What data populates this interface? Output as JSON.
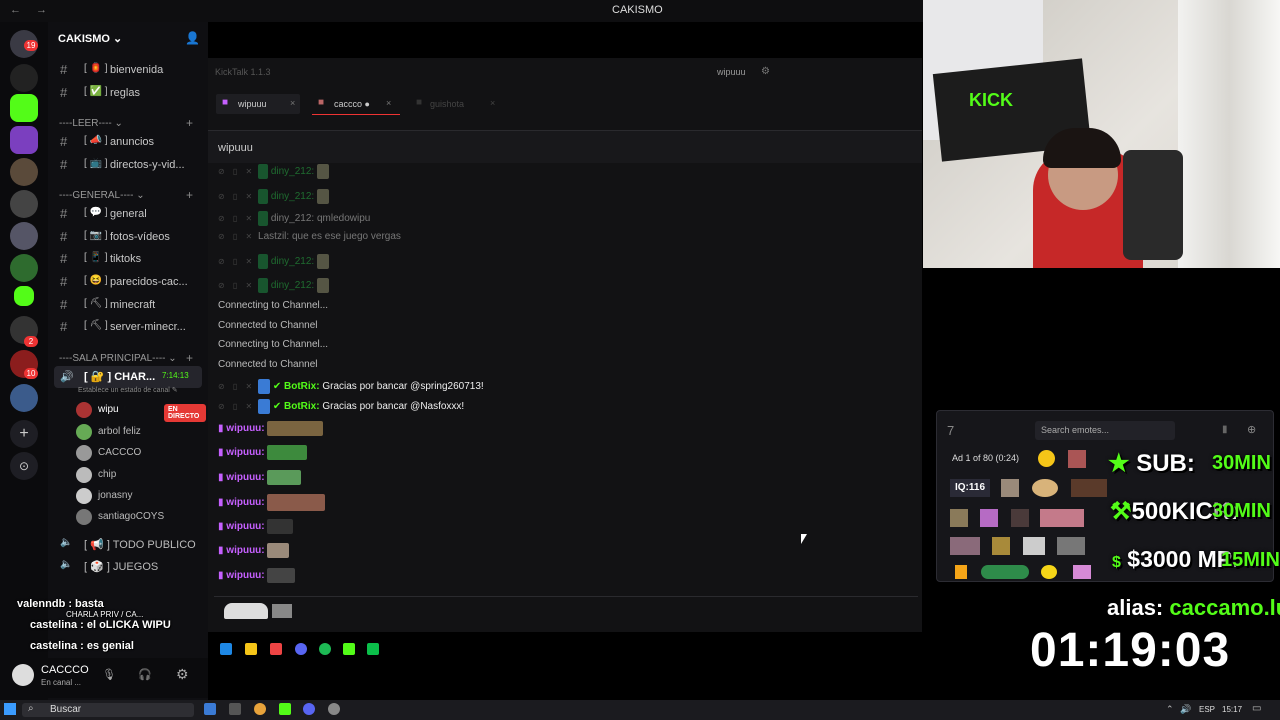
{
  "window": {
    "title": "CAKISMO",
    "nav_arrows": "← →"
  },
  "server": {
    "name": "CAKISMO ⌄"
  },
  "rail_badges": [
    "19",
    "2",
    "10"
  ],
  "channels_top": [
    {
      "emoji": "[ 🏮 ]",
      "name": "bienvenida"
    },
    {
      "emoji": "[ ✅ ]",
      "name": "reglas"
    }
  ],
  "categories": {
    "leer": "----LEER---- ⌄",
    "general": "----GENERAL---- ⌄",
    "sala": "----SALA PRINCIPAL---- ⌄"
  },
  "channels_leer": [
    {
      "emoji": "[ 📣 ]",
      "name": "anuncios"
    },
    {
      "emoji": "[ 📺 ]",
      "name": "directos-y-vid..."
    }
  ],
  "channels_general": [
    {
      "emoji": "[ 💬 ]",
      "name": "general"
    },
    {
      "emoji": "[ 📷 ]",
      "name": "fotos-vídeos"
    },
    {
      "emoji": "[ 📱 ]",
      "name": "tiktoks"
    },
    {
      "emoji": "[ 😆 ]",
      "name": "parecidos-cac..."
    },
    {
      "emoji": "[ ⛏ ]",
      "name": "minecraft"
    },
    {
      "emoji": "[ ⛏ ]",
      "name": "server-minecr..."
    }
  ],
  "voice_active": {
    "name": "[ 🔐 ] CHAR...",
    "timer": "7:14:13",
    "status": "Establece un estado de canal ✎"
  },
  "voice_users": [
    {
      "name": "wipu",
      "live": "EN DIRECTO"
    },
    {
      "name": "arbol feliz"
    },
    {
      "name": "CACCCO"
    },
    {
      "name": "chip"
    },
    {
      "name": "jonasny"
    },
    {
      "name": "santiagoCOYS"
    }
  ],
  "voice_channels": [
    {
      "name": "[ 📢 ] TODO PUBLICO"
    },
    {
      "name": "[ 🎲 ] JUEGOS"
    }
  ],
  "chat_overlay": [
    "valenndb : basta",
    "CHARLA PRIV / CA...",
    "castelina : el oLICKA WIPU",
    "castelina : es genial"
  ],
  "user_panel": {
    "name": "CACCCO",
    "status": "En canal ..."
  },
  "kicktalk": {
    "version": "KickTalk 1.1.3",
    "user": "wipuuu",
    "tabs": [
      "wipuuu",
      "caccco ●",
      "guishota"
    ],
    "channel": "wipuuu"
  },
  "messages_dim": [
    "diny_212:",
    "diny_212:",
    "diny_212: qmledowipu",
    "Lastzil: que es ese juego vergas",
    "diny_212:",
    "diny_212:"
  ],
  "system_msgs": [
    "Connecting to Channel...",
    "Connected to Channel",
    "Connecting to Channel...",
    "Connected to Channel"
  ],
  "bot_msgs": [
    {
      "user": "BotRix:",
      "text": "Gracias por bancar @spring260713!"
    },
    {
      "user": "BotRix:",
      "text": "Gracias por bancar @Nasfoxxx!"
    }
  ],
  "wipu_msgs": [
    "wipuuu:",
    "wipuuu:",
    "wipuuu:",
    "wipuuu:",
    "wipuuu:",
    "wipuuu:",
    "wipuuu:"
  ],
  "emote_panel": {
    "search_placeholder": "Search emotes...",
    "ad": "Ad 1 of 80 (0:24)",
    "iq": "IQ:116"
  },
  "stream_overlay": {
    "sub": {
      "label": "SUB:",
      "time": "30MIN"
    },
    "kick": {
      "label": "500KICK:",
      "time": "30MIN"
    },
    "mp": {
      "label": "$3000 MP:",
      "time": "15MIN"
    },
    "alias_label": "alias:",
    "alias": "caccamo.lucas",
    "timer": "01:19:03"
  },
  "taskbar": {
    "search": "Buscar",
    "lang": "ESP",
    "clock": "15:17"
  },
  "colors": {
    "kick_green": "#53fc18",
    "discord_bg": "#0f0f12",
    "live_red": "#e53935",
    "wipu_purple": "#c660ff"
  }
}
